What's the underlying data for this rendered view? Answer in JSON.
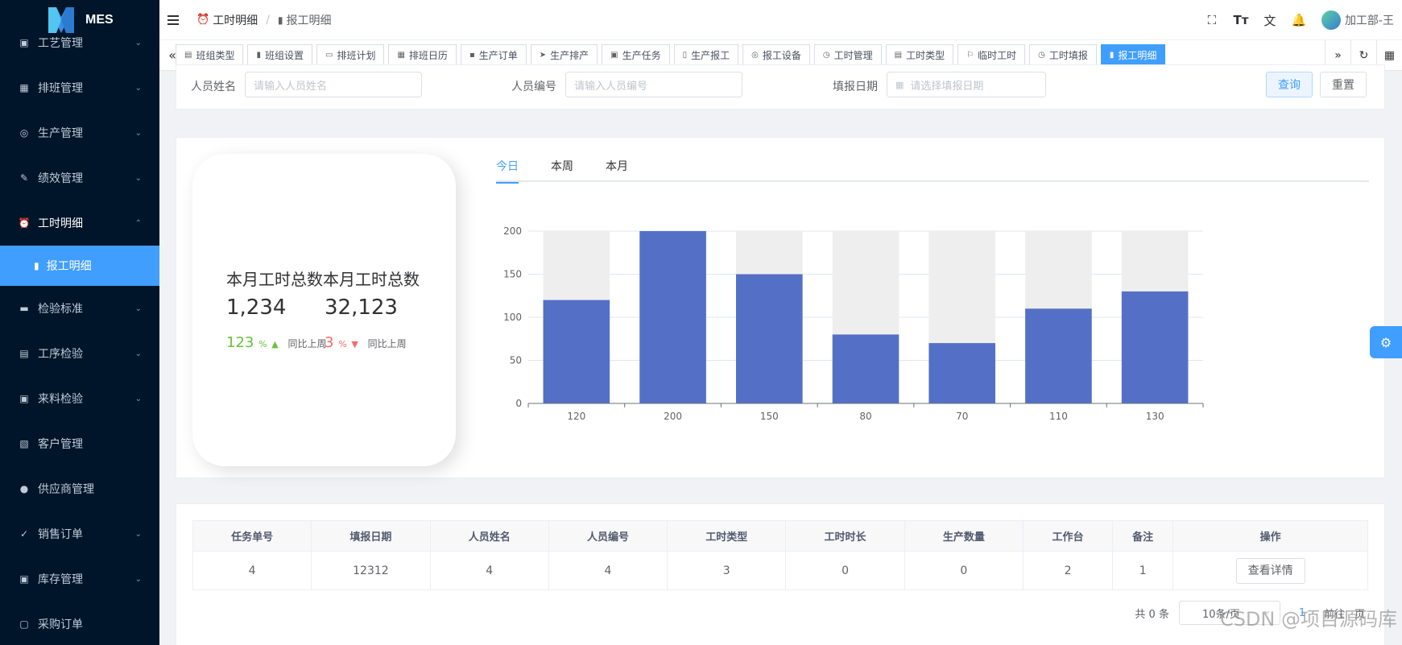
{
  "app": {
    "title": "MES"
  },
  "sidebar": {
    "items": [
      {
        "label": "工艺管理",
        "icon": "briefcase-icon",
        "glyph": "▣",
        "arrow": "⌄"
      },
      {
        "label": "排班管理",
        "icon": "calendar-icon",
        "glyph": "▦",
        "arrow": "⌄"
      },
      {
        "label": "生产管理",
        "icon": "database-icon",
        "glyph": "◎",
        "arrow": "⌄"
      },
      {
        "label": "绩效管理",
        "icon": "edit-icon",
        "glyph": "✎",
        "arrow": "⌄"
      },
      {
        "label": "工时明细",
        "icon": "alarm-clock-icon",
        "glyph": "⏰",
        "arrow": "⌃"
      },
      {
        "label": "检验标准",
        "icon": "monitor-icon",
        "glyph": "▬",
        "arrow": "⌄"
      },
      {
        "label": "工序检验",
        "icon": "book-icon",
        "glyph": "▤",
        "arrow": "⌄"
      },
      {
        "label": "来料检验",
        "icon": "briefcase-icon",
        "glyph": "▣",
        "arrow": "⌄"
      },
      {
        "label": "客户管理",
        "icon": "contact-card-icon",
        "glyph": "▧",
        "arrow": ""
      },
      {
        "label": "供应商管理",
        "icon": "user-icon",
        "glyph": "●",
        "arrow": ""
      },
      {
        "label": "销售订单",
        "icon": "chart-check-icon",
        "glyph": "✓",
        "arrow": "⌄"
      },
      {
        "label": "库存管理",
        "icon": "briefcase-icon",
        "glyph": "▣",
        "arrow": "⌄"
      },
      {
        "label": "采购订单",
        "icon": "cart-icon",
        "glyph": "▢",
        "arrow": ""
      }
    ],
    "active_sub": {
      "label": "报工明细",
      "glyph": "▮"
    }
  },
  "header": {
    "breadcrumb": [
      "工时明细",
      "报工明细"
    ],
    "breadcrumb_sep": "/",
    "user": "加工部-王"
  },
  "tags": [
    {
      "label": "班组类型",
      "glyph": "▤"
    },
    {
      "label": "班组设置",
      "glyph": "▮"
    },
    {
      "label": "排班计划",
      "glyph": "▭"
    },
    {
      "label": "排班日历",
      "glyph": "▦"
    },
    {
      "label": "生产订单",
      "glyph": "▪"
    },
    {
      "label": "生产排产",
      "glyph": "➤"
    },
    {
      "label": "生产任务",
      "glyph": "▣"
    },
    {
      "label": "生产报工",
      "glyph": "▯"
    },
    {
      "label": "报工设备",
      "glyph": "◎"
    },
    {
      "label": "工时管理",
      "glyph": "◷"
    },
    {
      "label": "工时类型",
      "glyph": "▤"
    },
    {
      "label": "临时工时",
      "glyph": "⚐"
    },
    {
      "label": "工时填报",
      "glyph": "◷"
    },
    {
      "label": "报工明细",
      "glyph": "▮",
      "active": true
    }
  ],
  "search": {
    "name_label": "人员姓名",
    "name_placeholder": "请输入人员姓名",
    "code_label": "人员编号",
    "code_placeholder": "请输入人员编号",
    "date_label": "填报日期",
    "date_placeholder": "请选择填报日期",
    "query_btn": "查询",
    "reset_btn": "重置"
  },
  "kpi": {
    "title": "本月工时总数本月工时总数",
    "value1": "1,234",
    "value2": "32,123",
    "pct1": "123",
    "pct2": "3",
    "unit": "%",
    "compare": "同比上周"
  },
  "tabs": [
    "今日",
    "本周",
    "本月"
  ],
  "chart_data": {
    "type": "bar",
    "categories": [
      "120",
      "200",
      "150",
      "80",
      "70",
      "110",
      "130"
    ],
    "values": [
      120,
      200,
      150,
      80,
      70,
      110,
      130
    ],
    "background_max": 200,
    "yticks": [
      0,
      50,
      100,
      150,
      200
    ],
    "ylim": [
      0,
      200
    ],
    "grid": true,
    "bar_color": "#5470c6",
    "background_color": "#eeeeee"
  },
  "table": {
    "columns": [
      "任务单号",
      "填报日期",
      "人员姓名",
      "人员编号",
      "工时类型",
      "工时时长",
      "生产数量",
      "工作台",
      "备注",
      "操作"
    ],
    "rows": [
      [
        "4",
        "12312",
        "4",
        "4",
        "3",
        "0",
        "0",
        "2",
        "1"
      ]
    ],
    "action_label": "查看详情"
  },
  "pagination": {
    "total": "共 0 条",
    "page_size": "10条/页",
    "page": "1",
    "goto": "前往",
    "goto_suffix": "页"
  },
  "watermark": "CSDN @项目源码库",
  "colors": {
    "primary": "#409eff",
    "sidebar": "#001529",
    "up": "#67c23a",
    "down": "#f56c6c"
  }
}
